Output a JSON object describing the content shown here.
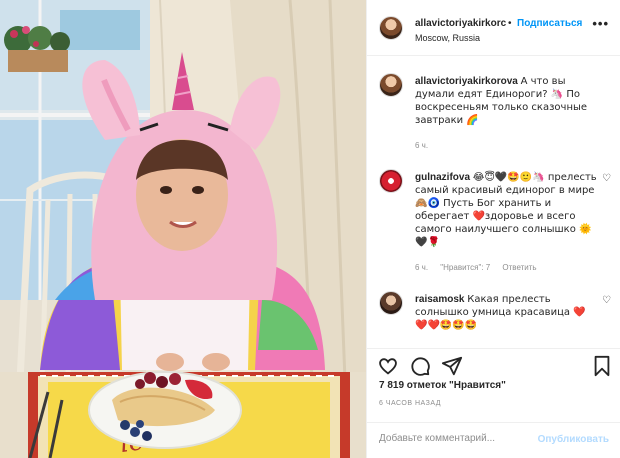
{
  "header": {
    "username": "allavictoriyakirkorc",
    "separator": "•",
    "follow_label": "Подписаться",
    "location": "Moscow, Russia",
    "more_label": "•••"
  },
  "comments": [
    {
      "username": "allavictoriyakirkorova",
      "text": "А что вы думали едят Единороги? 🦄 По воскресеньям только сказочные завтраки 🌈",
      "age": "6 ч."
    },
    {
      "username": "gulnazifova",
      "text": "😂😇🖤🤩🙂🦄 прелесть самый красивый единорог в мире 🙈🧿 Пусть Бог хранить и оберегает ❤️здоровье и всего самого наилучшего солнышко 🌞🖤🌹",
      "age": "6 ч.",
      "likes": "\"Нравится\": 7",
      "reply": "Ответить"
    },
    {
      "username": "raisamosk",
      "text": "Какая прелесть солнышко умница красавица ❤️ ❤️❤️🤩🤩🤩"
    }
  ],
  "likes": "7 819 отметок \"Нравится\"",
  "posted": "6 часов назад",
  "add_comment": {
    "placeholder": "Добавьте комментарий...",
    "post_label": "Опубликовать"
  },
  "colors": {
    "link_blue": "#0095f6",
    "muted": "#8e8e8e",
    "border": "#efefef"
  },
  "icons": [
    "heart-icon",
    "comment-icon",
    "share-icon",
    "bookmark-icon",
    "more-icon"
  ]
}
